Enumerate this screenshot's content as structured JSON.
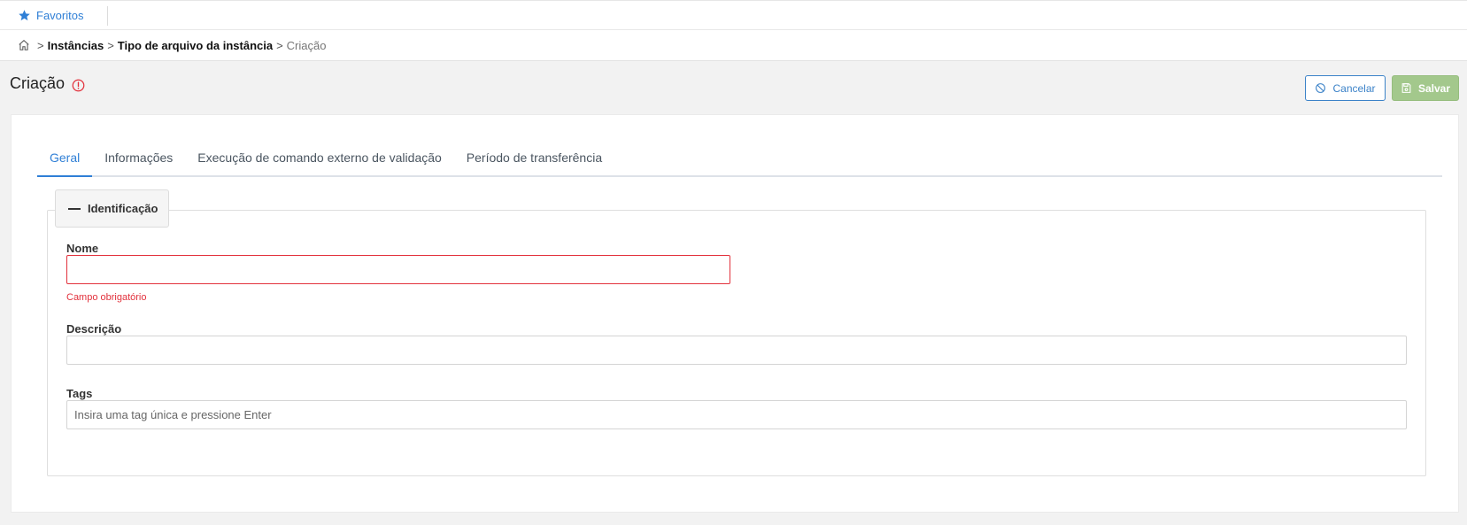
{
  "topbar": {
    "favorites_label": "Favoritos"
  },
  "breadcrumb": {
    "items": [
      "Instâncias",
      "Tipo de arquivo da instância"
    ],
    "current": "Criação",
    "separator": ">"
  },
  "header": {
    "title": "Criação",
    "cancel_label": "Cancelar",
    "save_label": "Salvar"
  },
  "tabs": [
    {
      "label": "Geral",
      "active": true
    },
    {
      "label": "Informações",
      "active": false
    },
    {
      "label": "Execução de comando externo de validação",
      "active": false
    },
    {
      "label": "Período de transferência",
      "active": false
    }
  ],
  "section": {
    "title": "Identificação",
    "fields": {
      "nome": {
        "label": "Nome",
        "value": "",
        "error": "Campo obrigatório"
      },
      "descricao": {
        "label": "Descrição",
        "value": ""
      },
      "tags": {
        "label": "Tags",
        "value": "",
        "placeholder": "Insira uma tag única e pressione Enter"
      }
    }
  },
  "colors": {
    "accent": "#2f7fd6",
    "error": "#e2313c",
    "save_disabled": "#a3c88c"
  },
  "icons": {
    "favorites": "star-icon",
    "home": "home-icon",
    "warning": "alert-circle-icon",
    "cancel": "ban-icon",
    "save": "floppy-disk-icon"
  }
}
